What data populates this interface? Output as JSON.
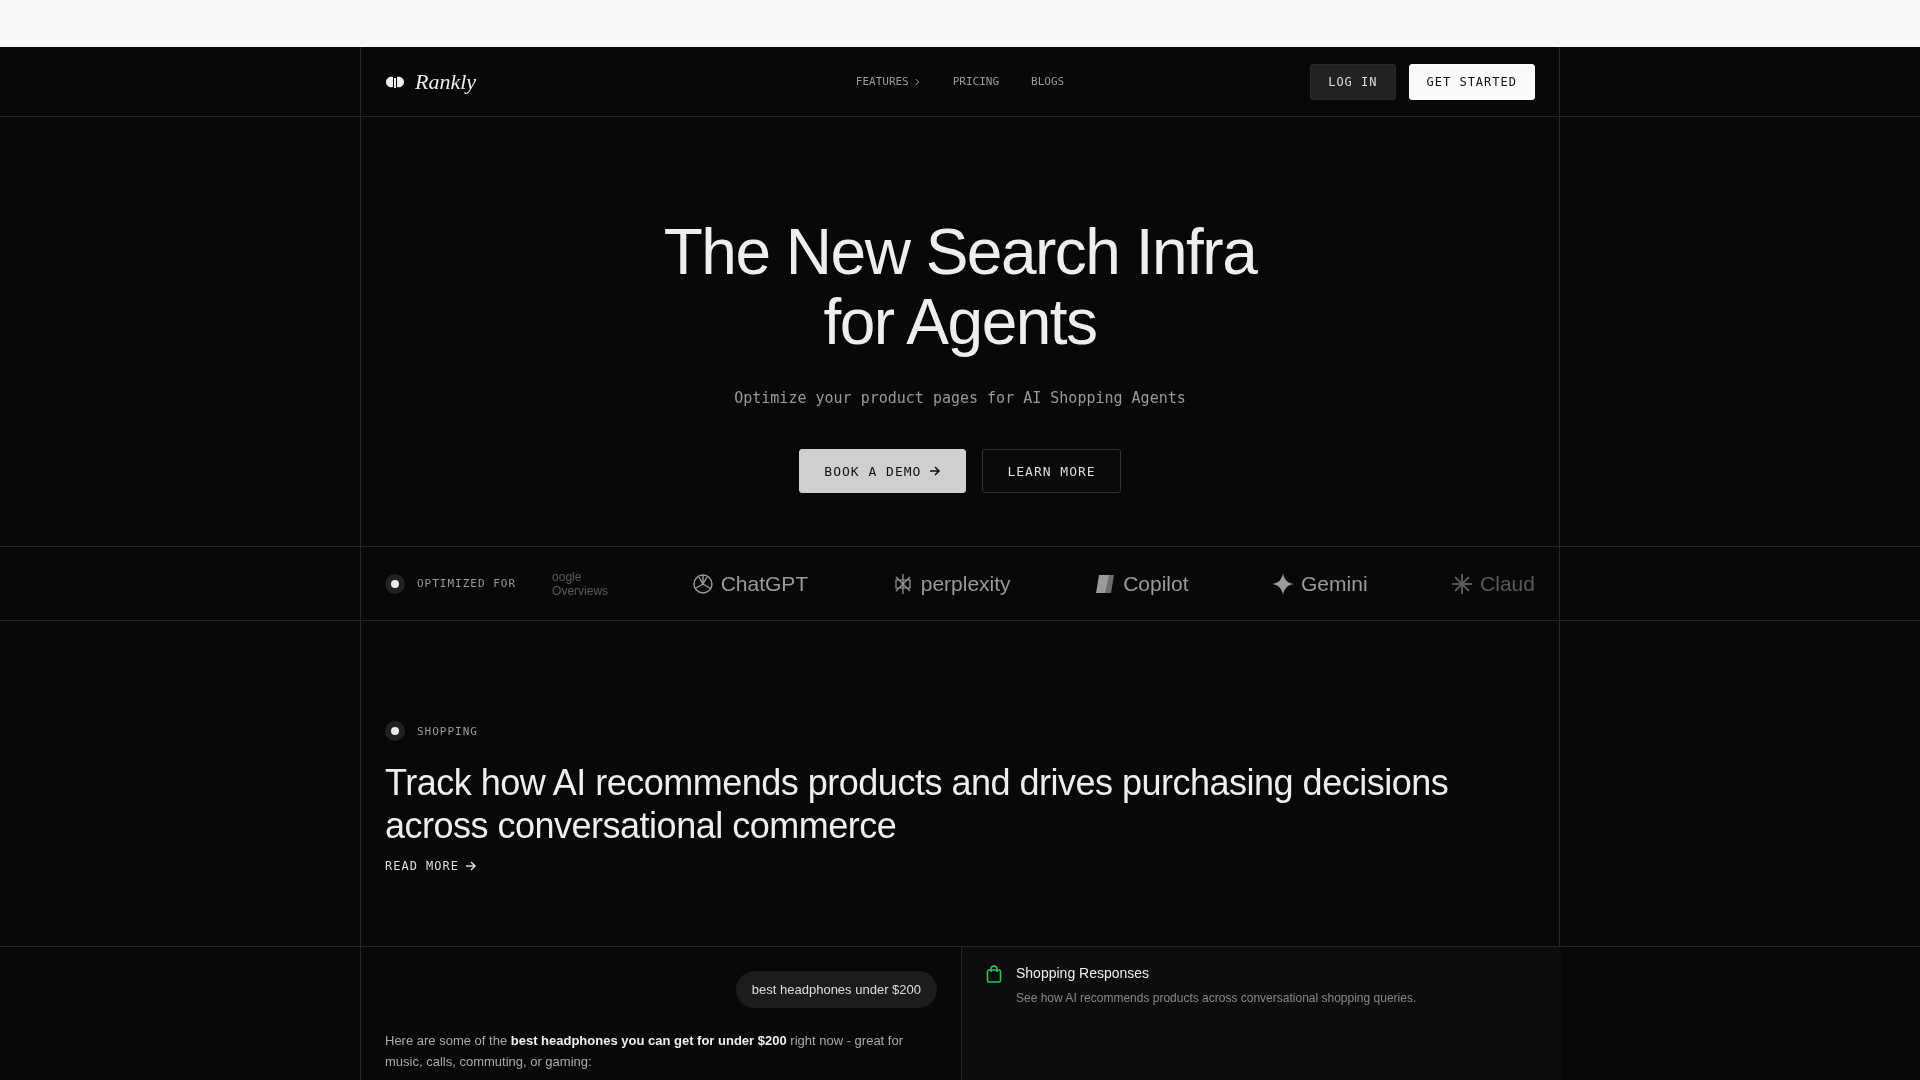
{
  "nav": {
    "brand": "Rankly",
    "links": [
      {
        "label": "FEATURES",
        "has_submenu": true
      },
      {
        "label": "PRICING",
        "has_submenu": false
      },
      {
        "label": "BLOGS",
        "has_submenu": false
      }
    ],
    "login": "LOG IN",
    "cta": "GET STARTED"
  },
  "hero": {
    "title_lines": [
      "The New Search Infra",
      "for Agents"
    ],
    "subtitle": "Optimize your product pages for AI Shopping Agents",
    "primary": "BOOK A DEMO",
    "secondary": "LEARN MORE"
  },
  "strip": {
    "label": "OPTIMIZED FOR",
    "logos": [
      {
        "kind": "google",
        "lines": [
          "oogle",
          "Overviews"
        ]
      },
      {
        "kind": "chatgpt",
        "lines": [
          "ChatGPT"
        ]
      },
      {
        "kind": "perplexity",
        "lines": [
          "perplexity"
        ]
      },
      {
        "kind": "copilot",
        "lines": [
          "Copilot"
        ]
      },
      {
        "kind": "gemini",
        "lines": [
          "Gemini"
        ]
      },
      {
        "kind": "claude",
        "lines": [
          "Claud"
        ]
      }
    ]
  },
  "section": {
    "tag": "SHOPPING",
    "heading": "Track how AI recommends products and drives purchasing decisions across conversational commerce",
    "link": "READ MORE"
  },
  "chat": {
    "query": "best headphones under $200",
    "answer": "Here are some of the **best headphones you can get for under $200** right now - great for music, calls, commuting, or gaming:"
  },
  "feature": {
    "title": "Shopping Responses",
    "description": "See how AI recommends products across conversational shopping queries."
  }
}
